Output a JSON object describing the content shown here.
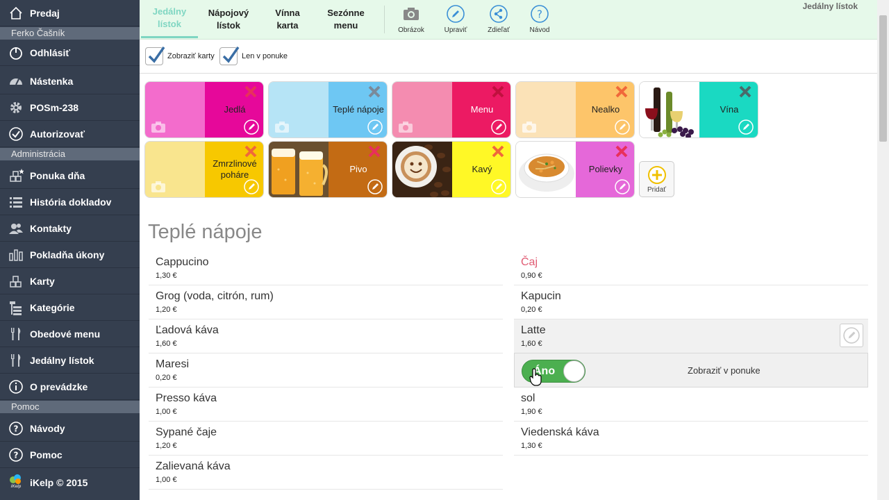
{
  "sidebar": {
    "top_item": {
      "label": "Predaj",
      "icon": "home-icon"
    },
    "user_name": "Ferko Čašník",
    "user_items": [
      {
        "label": "Odhlásiť",
        "icon": "power-icon"
      },
      {
        "label": "Nástenka",
        "icon": "dashboard-icon"
      },
      {
        "label": "POSm-238",
        "icon": "gear-icon"
      },
      {
        "label": "Autorizovať",
        "icon": "check-circle-icon"
      }
    ],
    "admin_header": "Administrácia",
    "admin_items": [
      {
        "label": "Ponuka dňa",
        "icon": "blocks-star-icon"
      },
      {
        "label": "História dokladov",
        "icon": "list-icon"
      },
      {
        "label": "Kontakty",
        "icon": "users-icon"
      },
      {
        "label": "Pokladňa úkony",
        "icon": "bars-icon"
      },
      {
        "label": "Karty",
        "icon": "blocks-icon"
      },
      {
        "label": "Kategórie",
        "icon": "tree-icon"
      },
      {
        "label": "Obedové menu",
        "icon": "fork-knife-icon"
      },
      {
        "label": "Jedálny lístok",
        "icon": "fork-knife-icon"
      },
      {
        "label": "O prevádzke",
        "icon": "info-icon"
      }
    ],
    "help_header": "Pomoc",
    "help_items": [
      {
        "label": "Návody",
        "icon": "question-icon"
      },
      {
        "label": "Pomoc",
        "icon": "question-icon"
      }
    ],
    "footer": {
      "label": "iKelp © 2015",
      "logo_text": "iKelp"
    }
  },
  "topbar": {
    "tabs": [
      {
        "label": "Jedálny lístok",
        "active": true
      },
      {
        "label": "Nápojový lístok",
        "active": false
      },
      {
        "label": "Vínna karta",
        "active": false
      },
      {
        "label": "Sezónne menu",
        "active": false
      }
    ],
    "tools": [
      {
        "label": "Obrázok",
        "icon": "camera-icon"
      },
      {
        "label": "Upraviť",
        "icon": "pencil-icon"
      },
      {
        "label": "Zdieľať",
        "icon": "share-icon"
      },
      {
        "label": "Návod",
        "icon": "question-icon"
      }
    ],
    "page_label": "Jedálny lístok",
    "accent": "#7fd6c2"
  },
  "filters": [
    {
      "label": "Zobraziť karty",
      "checked": true
    },
    {
      "label": "Len v ponuke",
      "checked": true
    }
  ],
  "categories": [
    {
      "label": "Jedlá",
      "left": "#f36ccc",
      "right": "#e6089a",
      "image": null
    },
    {
      "label": "Teplé nápoje",
      "left": "#b6e4f6",
      "right": "#6ec7f3",
      "image": null
    },
    {
      "label": "Menu",
      "left": "#f48cb0",
      "right": "#ec1a63",
      "image": null
    },
    {
      "label": "Nealko",
      "left": "#fbe2b7",
      "right": "#fdc56a",
      "image": null
    },
    {
      "label": "Vína",
      "left": "#ffffff",
      "right": "#1ad9c2",
      "image": "wine-photo"
    },
    {
      "label": "Zmrzlinové poháre",
      "left": "#f9e58e",
      "right": "#f7c800",
      "image": null
    },
    {
      "label": "Pivo",
      "left": "#e8c9a0",
      "right": "#c36b14",
      "image": "beer-photo"
    },
    {
      "label": "Kavý",
      "left": "#5a3a22",
      "right": "#fff826",
      "image": "coffee-photo"
    },
    {
      "label": "Polievky",
      "left": "#ffffff",
      "right": "#e568d9",
      "image": "soup-photo"
    }
  ],
  "add_label": "Pridať",
  "section": {
    "title": "Teplé nápoje",
    "left_items": [
      {
        "name": "Cappucino",
        "price": "1,30 €"
      },
      {
        "name": "Grog (voda, citrón, rum)",
        "price": "1,20 €"
      },
      {
        "name": "Ľadová káva",
        "price": "1,60 €"
      },
      {
        "name": "Maresi",
        "price": "0,20 €"
      },
      {
        "name": "Presso káva",
        "price": "1,00 €"
      },
      {
        "name": "Sypané čaje",
        "price": "1,20 €"
      },
      {
        "name": "Zalievaná káva",
        "price": "1,00 €"
      }
    ],
    "right_items": [
      {
        "name": "Čaj",
        "price": "0,90 €",
        "highlight": true
      },
      {
        "name": "Kapucin",
        "price": "0,20 €"
      },
      {
        "name": "Latte",
        "price": "1,60 €",
        "selected": true
      },
      {
        "name": "sol",
        "price": "1,90 €"
      },
      {
        "name": "Viedenská káva",
        "price": "1,30 €"
      }
    ],
    "toggle": {
      "state_label": "Áno",
      "on": true,
      "label": "Zobraziť v ponuke"
    }
  }
}
